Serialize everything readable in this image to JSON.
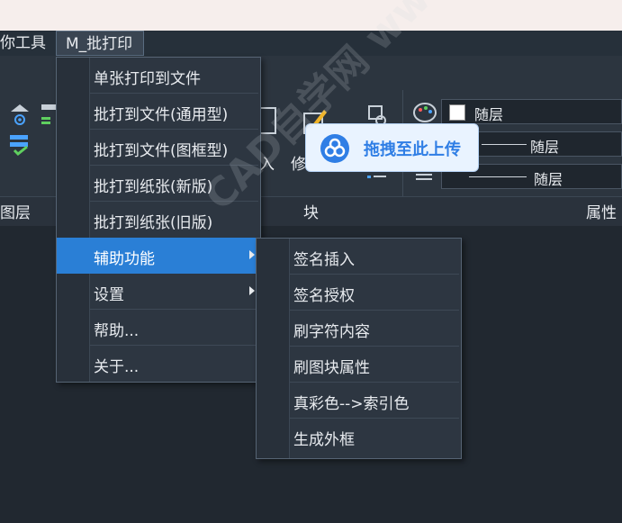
{
  "menubar": {
    "item_tools": "你工具",
    "item_batch": "M_批打印"
  },
  "ribbon": {
    "partial_left": "入",
    "partial_modify": "修",
    "layer_label": "图层",
    "block_label": "块",
    "properties_label": "属性",
    "color_value": "随层",
    "linetype_value": "随层",
    "lineweight_value": "随层"
  },
  "main_menu": {
    "items": [
      {
        "label": "单张打印到文件"
      },
      {
        "label": "批打到文件(通用型)"
      },
      {
        "label": "批打到文件(图框型)"
      },
      {
        "label": "批打到纸张(新版)"
      },
      {
        "label": "批打到纸张(旧版)"
      },
      {
        "label": "辅助功能"
      },
      {
        "label": "设置"
      },
      {
        "label": "帮助..."
      },
      {
        "label": "关于..."
      }
    ]
  },
  "sub_menu": {
    "items": [
      {
        "label": "签名插入"
      },
      {
        "label": "签名授权"
      },
      {
        "label": "刷字符内容"
      },
      {
        "label": "刷图块属性"
      },
      {
        "label": "真彩色-->索引色"
      },
      {
        "label": "生成外框"
      }
    ]
  },
  "upload_badge": {
    "label": "拖拽至此上传"
  },
  "watermark": {
    "text": "CAD自学网 www.cadzxw.com"
  },
  "colors": {
    "accent": "#2a7fd6",
    "upload_text": "#2f7ee5"
  }
}
